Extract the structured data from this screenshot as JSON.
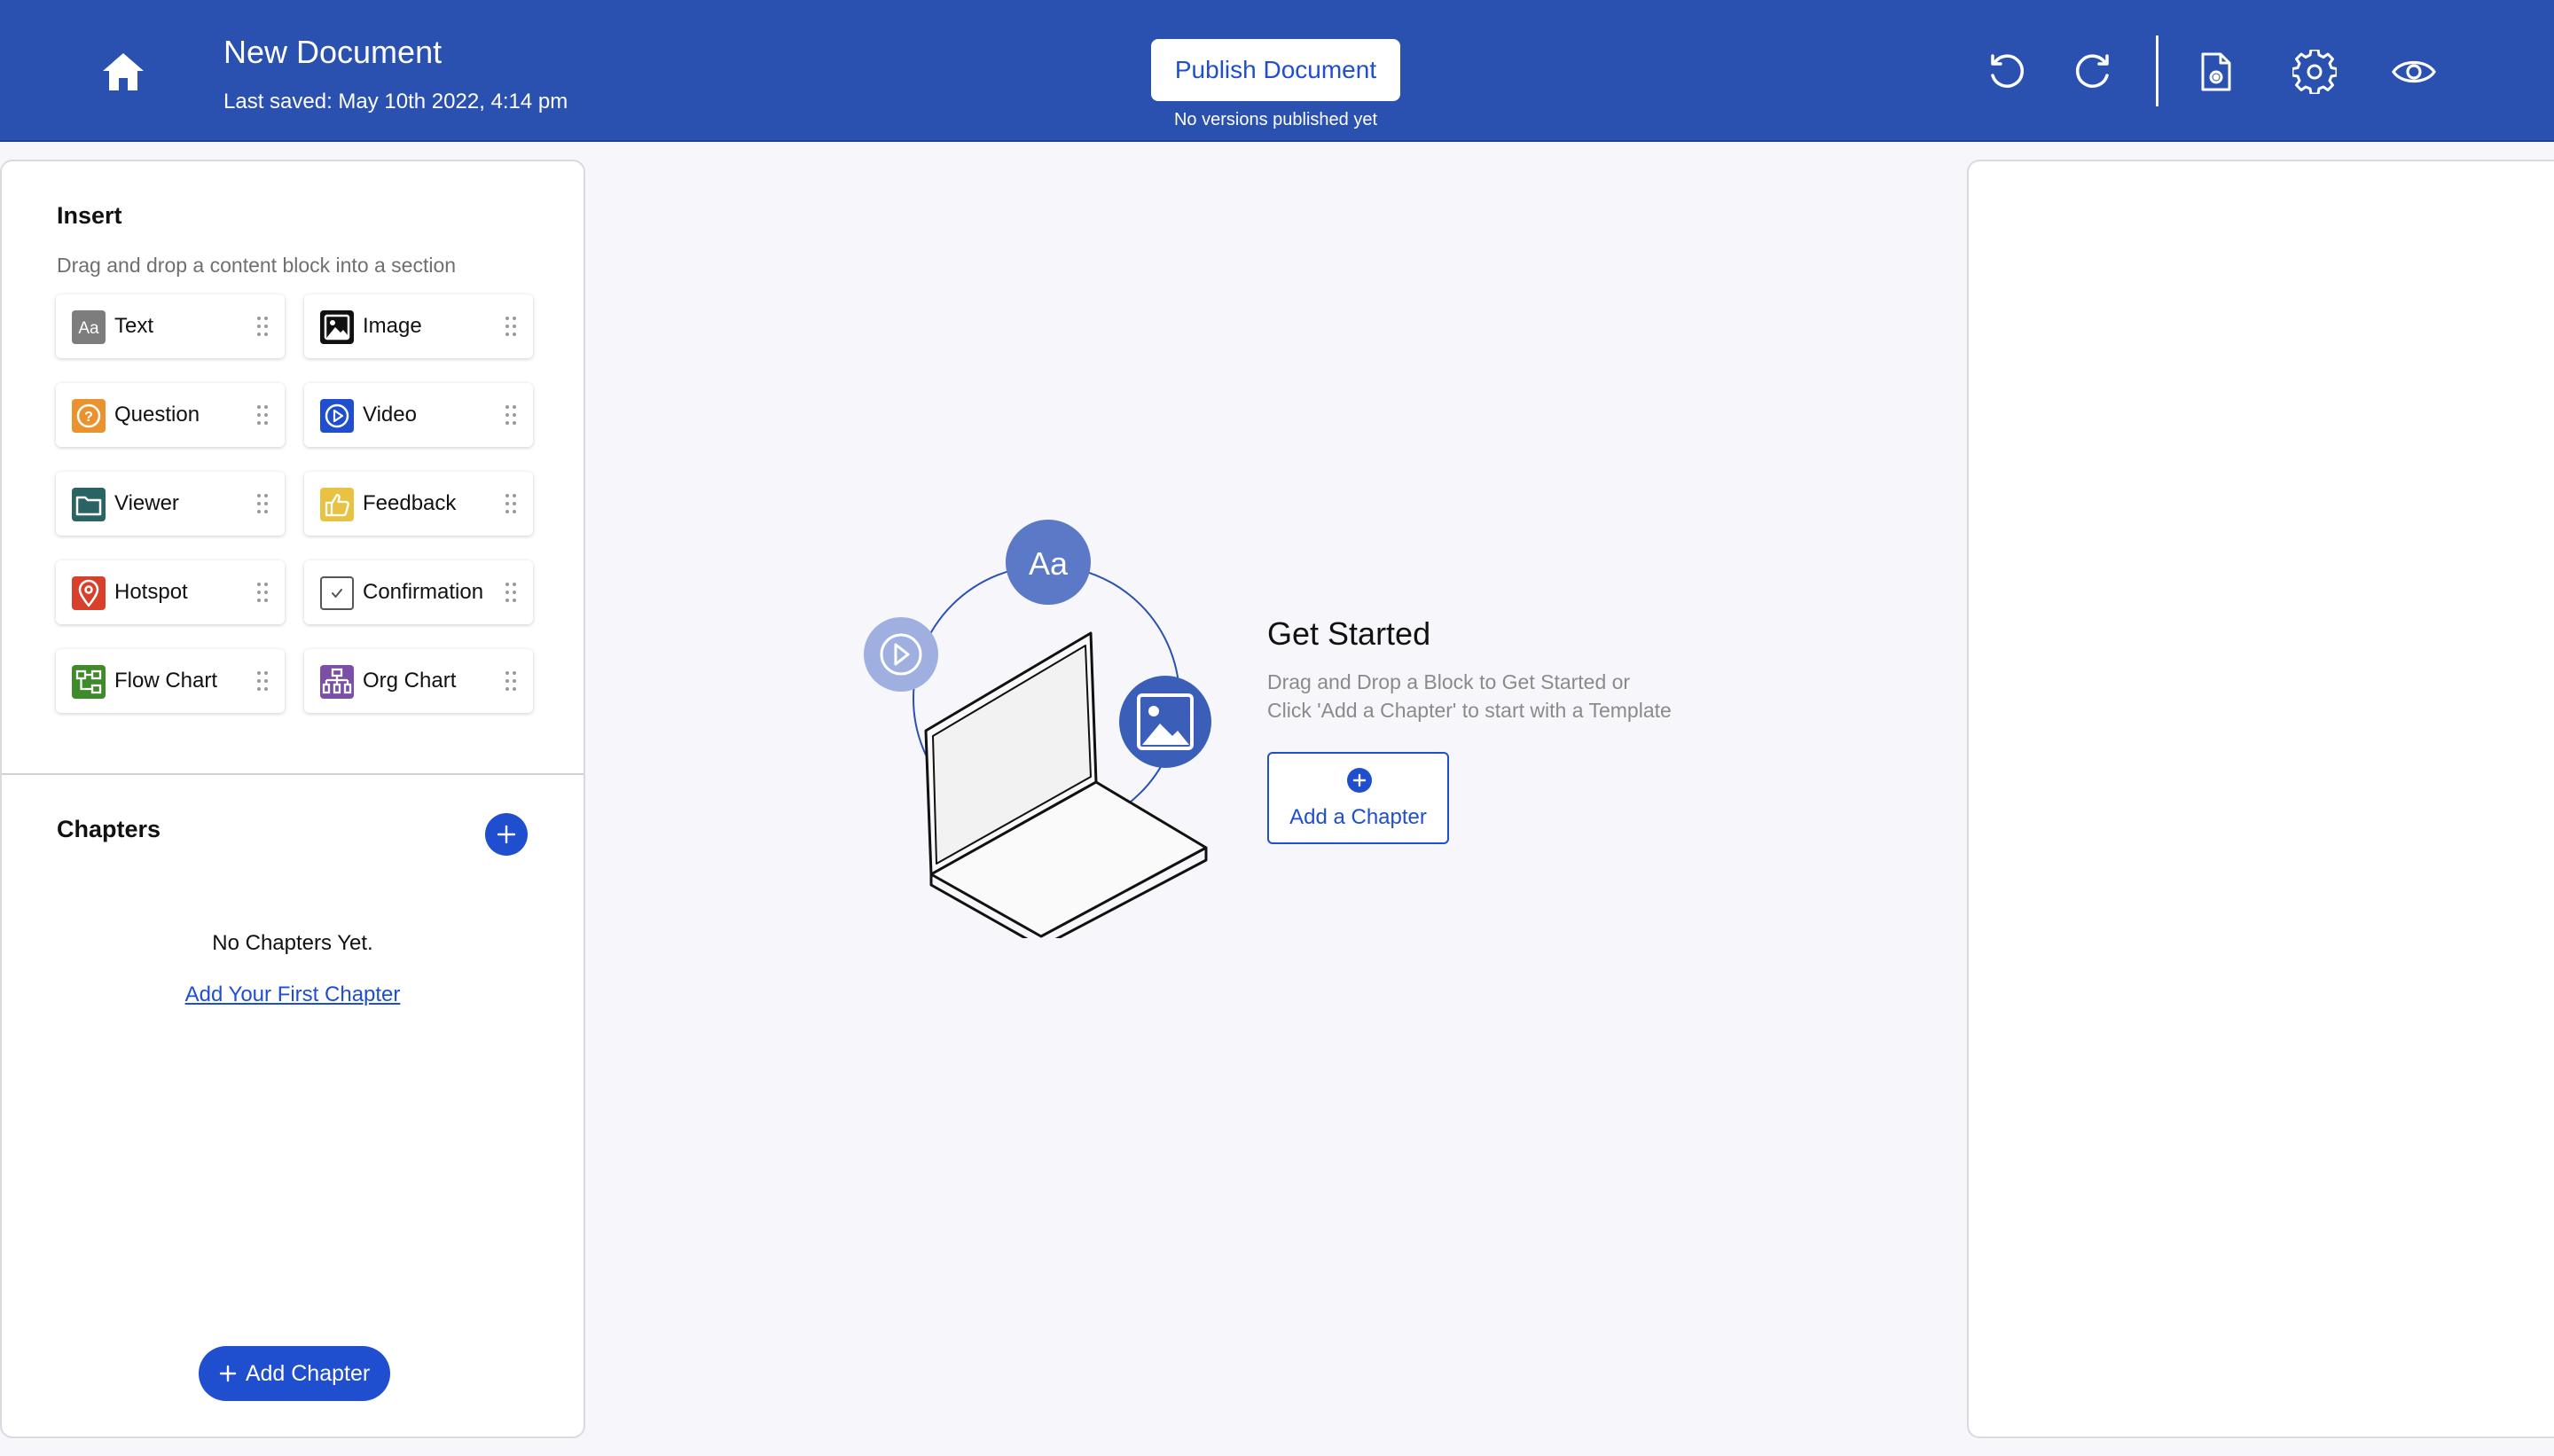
{
  "header": {
    "title": "New Document",
    "last_saved": "Last saved: May 10th 2022, 4:14 pm",
    "publish_label": "Publish Document",
    "publish_note": "No versions published yet",
    "icons": [
      "home-icon",
      "undo-icon",
      "redo-icon",
      "document-settings-icon",
      "gear-icon",
      "eye-icon"
    ]
  },
  "insert": {
    "title": "Insert",
    "subtitle": "Drag and drop a content block into a section",
    "blocks": [
      {
        "label": "Text",
        "icon": "text-icon",
        "color": "#7d7d7d"
      },
      {
        "label": "Image",
        "icon": "image-icon",
        "color": "#111111"
      },
      {
        "label": "Question",
        "icon": "question-icon",
        "color": "#e9922e"
      },
      {
        "label": "Video",
        "icon": "video-icon",
        "color": "#1f4fcf"
      },
      {
        "label": "Viewer",
        "icon": "folder-icon",
        "color": "#2a6363"
      },
      {
        "label": "Feedback",
        "icon": "thumbs-up-icon",
        "color": "#e8c242"
      },
      {
        "label": "Hotspot",
        "icon": "location-pin-icon",
        "color": "#d9402b"
      },
      {
        "label": "Confirmation",
        "icon": "checkbox-icon",
        "color": "#555555"
      },
      {
        "label": "Flow Chart",
        "icon": "flow-chart-icon",
        "color": "#3f8a2a"
      },
      {
        "label": "Org Chart",
        "icon": "org-chart-icon",
        "color": "#7b4fa8"
      }
    ]
  },
  "chapters": {
    "title": "Chapters",
    "empty_text": "No Chapters Yet.",
    "first_link": "Add Your First Chapter",
    "add_button": "Add Chapter"
  },
  "center": {
    "badge_text": "Aa",
    "title": "Get Started",
    "line1": "Drag and Drop a Block to Get Started or",
    "line2": "Click 'Add a Chapter' to start with a Template",
    "add_label": "Add a Chapter"
  },
  "colors": {
    "header": "#2a50b0",
    "accent": "#1f4fcf",
    "background": "#f7f7fb"
  }
}
